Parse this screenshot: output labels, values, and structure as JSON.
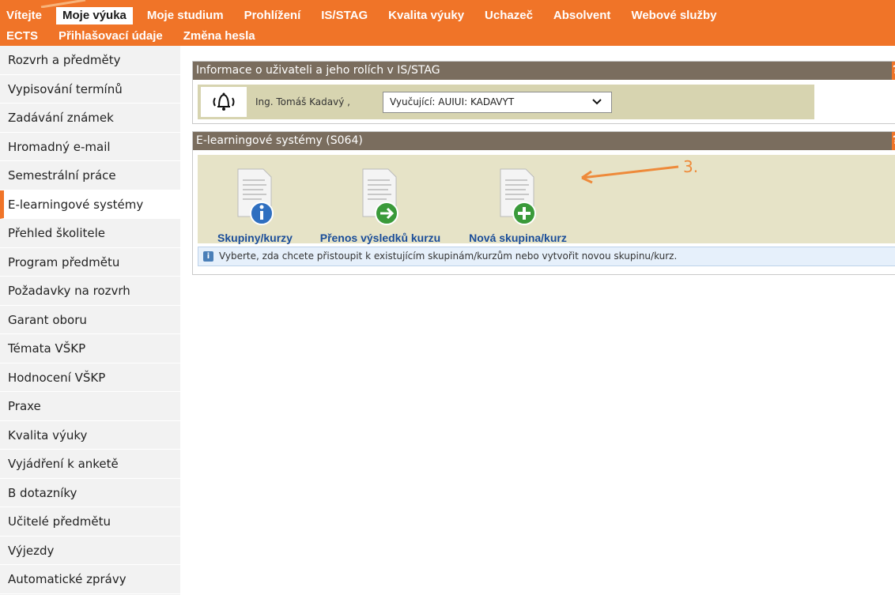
{
  "topnav": {
    "row1": [
      "Vítejte",
      "Moje výuka",
      "Moje studium",
      "Prohlížení",
      "IS/STAG",
      "Kvalita výuky",
      "Uchazeč",
      "Absolvent",
      "Webové služby"
    ],
    "row2": [
      "ECTS",
      "Přihlašovací údaje",
      "Změna hesla"
    ],
    "active": "Moje výuka",
    "colors": {
      "bar": "#f07428",
      "text": "#ffffff"
    }
  },
  "sidebar": {
    "items": [
      "Rozvrh a předměty",
      "Vypisování termínů",
      "Zadávání známek",
      "Hromadný e-mail",
      "Semestrální práce",
      "E-learningové systémy",
      "Přehled školitele",
      "Program předmětu",
      "Požadavky na rozvrh",
      "Garant oboru",
      "Témata VŠKP",
      "Hodnocení VŠKP",
      "Praxe",
      "Kvalita výuky",
      "Vyjádření k anketě",
      "B dotazníky",
      "Učitelé předmětu",
      "Výjezdy",
      "Automatické zprávy"
    ],
    "active": "E-learningové systémy"
  },
  "user_panel": {
    "title": "Informace o uživateli a jeho rolích v IS/STAG",
    "help": "?",
    "bell_icon": "bell-icon",
    "user_name": "Ing. Tomáš Kadavý ,",
    "role_selected": "Vyučující: AUIUI: KADAVYT"
  },
  "elearn_panel": {
    "title": "E-learningové systémy (S064)",
    "help": "?",
    "tiles": [
      {
        "label": "Skupiny/kurzy",
        "icon": "info-icon",
        "color": "#2f6fc0"
      },
      {
        "label": "Přenos výsledků kurzu",
        "icon": "arrow-right-icon",
        "color": "#3a9a3a"
      },
      {
        "label": "Nová skupina/kurz",
        "icon": "plus-icon",
        "color": "#3a9a3a"
      }
    ],
    "info_text": "Vyberte, zda chcete přistoupit k existujícím skupinám/kurzům nebo vytvořit novou skupinu/kurz."
  },
  "annotation": {
    "label": "3.",
    "color": "#ee8a3a"
  }
}
